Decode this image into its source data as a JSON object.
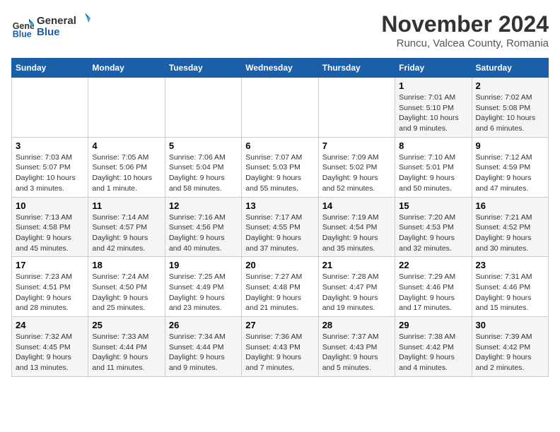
{
  "header": {
    "logo_line1": "General",
    "logo_line2": "Blue",
    "month_title": "November 2024",
    "subtitle": "Runcu, Valcea County, Romania"
  },
  "weekdays": [
    "Sunday",
    "Monday",
    "Tuesday",
    "Wednesday",
    "Thursday",
    "Friday",
    "Saturday"
  ],
  "weeks": [
    [
      {
        "day": "",
        "info": ""
      },
      {
        "day": "",
        "info": ""
      },
      {
        "day": "",
        "info": ""
      },
      {
        "day": "",
        "info": ""
      },
      {
        "day": "",
        "info": ""
      },
      {
        "day": "1",
        "info": "Sunrise: 7:01 AM\nSunset: 5:10 PM\nDaylight: 10 hours\nand 9 minutes."
      },
      {
        "day": "2",
        "info": "Sunrise: 7:02 AM\nSunset: 5:08 PM\nDaylight: 10 hours\nand 6 minutes."
      }
    ],
    [
      {
        "day": "3",
        "info": "Sunrise: 7:03 AM\nSunset: 5:07 PM\nDaylight: 10 hours\nand 3 minutes."
      },
      {
        "day": "4",
        "info": "Sunrise: 7:05 AM\nSunset: 5:06 PM\nDaylight: 10 hours\nand 1 minute."
      },
      {
        "day": "5",
        "info": "Sunrise: 7:06 AM\nSunset: 5:04 PM\nDaylight: 9 hours\nand 58 minutes."
      },
      {
        "day": "6",
        "info": "Sunrise: 7:07 AM\nSunset: 5:03 PM\nDaylight: 9 hours\nand 55 minutes."
      },
      {
        "day": "7",
        "info": "Sunrise: 7:09 AM\nSunset: 5:02 PM\nDaylight: 9 hours\nand 52 minutes."
      },
      {
        "day": "8",
        "info": "Sunrise: 7:10 AM\nSunset: 5:01 PM\nDaylight: 9 hours\nand 50 minutes."
      },
      {
        "day": "9",
        "info": "Sunrise: 7:12 AM\nSunset: 4:59 PM\nDaylight: 9 hours\nand 47 minutes."
      }
    ],
    [
      {
        "day": "10",
        "info": "Sunrise: 7:13 AM\nSunset: 4:58 PM\nDaylight: 9 hours\nand 45 minutes."
      },
      {
        "day": "11",
        "info": "Sunrise: 7:14 AM\nSunset: 4:57 PM\nDaylight: 9 hours\nand 42 minutes."
      },
      {
        "day": "12",
        "info": "Sunrise: 7:16 AM\nSunset: 4:56 PM\nDaylight: 9 hours\nand 40 minutes."
      },
      {
        "day": "13",
        "info": "Sunrise: 7:17 AM\nSunset: 4:55 PM\nDaylight: 9 hours\nand 37 minutes."
      },
      {
        "day": "14",
        "info": "Sunrise: 7:19 AM\nSunset: 4:54 PM\nDaylight: 9 hours\nand 35 minutes."
      },
      {
        "day": "15",
        "info": "Sunrise: 7:20 AM\nSunset: 4:53 PM\nDaylight: 9 hours\nand 32 minutes."
      },
      {
        "day": "16",
        "info": "Sunrise: 7:21 AM\nSunset: 4:52 PM\nDaylight: 9 hours\nand 30 minutes."
      }
    ],
    [
      {
        "day": "17",
        "info": "Sunrise: 7:23 AM\nSunset: 4:51 PM\nDaylight: 9 hours\nand 28 minutes."
      },
      {
        "day": "18",
        "info": "Sunrise: 7:24 AM\nSunset: 4:50 PM\nDaylight: 9 hours\nand 25 minutes."
      },
      {
        "day": "19",
        "info": "Sunrise: 7:25 AM\nSunset: 4:49 PM\nDaylight: 9 hours\nand 23 minutes."
      },
      {
        "day": "20",
        "info": "Sunrise: 7:27 AM\nSunset: 4:48 PM\nDaylight: 9 hours\nand 21 minutes."
      },
      {
        "day": "21",
        "info": "Sunrise: 7:28 AM\nSunset: 4:47 PM\nDaylight: 9 hours\nand 19 minutes."
      },
      {
        "day": "22",
        "info": "Sunrise: 7:29 AM\nSunset: 4:46 PM\nDaylight: 9 hours\nand 17 minutes."
      },
      {
        "day": "23",
        "info": "Sunrise: 7:31 AM\nSunset: 4:46 PM\nDaylight: 9 hours\nand 15 minutes."
      }
    ],
    [
      {
        "day": "24",
        "info": "Sunrise: 7:32 AM\nSunset: 4:45 PM\nDaylight: 9 hours\nand 13 minutes."
      },
      {
        "day": "25",
        "info": "Sunrise: 7:33 AM\nSunset: 4:44 PM\nDaylight: 9 hours\nand 11 minutes."
      },
      {
        "day": "26",
        "info": "Sunrise: 7:34 AM\nSunset: 4:44 PM\nDaylight: 9 hours\nand 9 minutes."
      },
      {
        "day": "27",
        "info": "Sunrise: 7:36 AM\nSunset: 4:43 PM\nDaylight: 9 hours\nand 7 minutes."
      },
      {
        "day": "28",
        "info": "Sunrise: 7:37 AM\nSunset: 4:43 PM\nDaylight: 9 hours\nand 5 minutes."
      },
      {
        "day": "29",
        "info": "Sunrise: 7:38 AM\nSunset: 4:42 PM\nDaylight: 9 hours\nand 4 minutes."
      },
      {
        "day": "30",
        "info": "Sunrise: 7:39 AM\nSunset: 4:42 PM\nDaylight: 9 hours\nand 2 minutes."
      }
    ]
  ]
}
